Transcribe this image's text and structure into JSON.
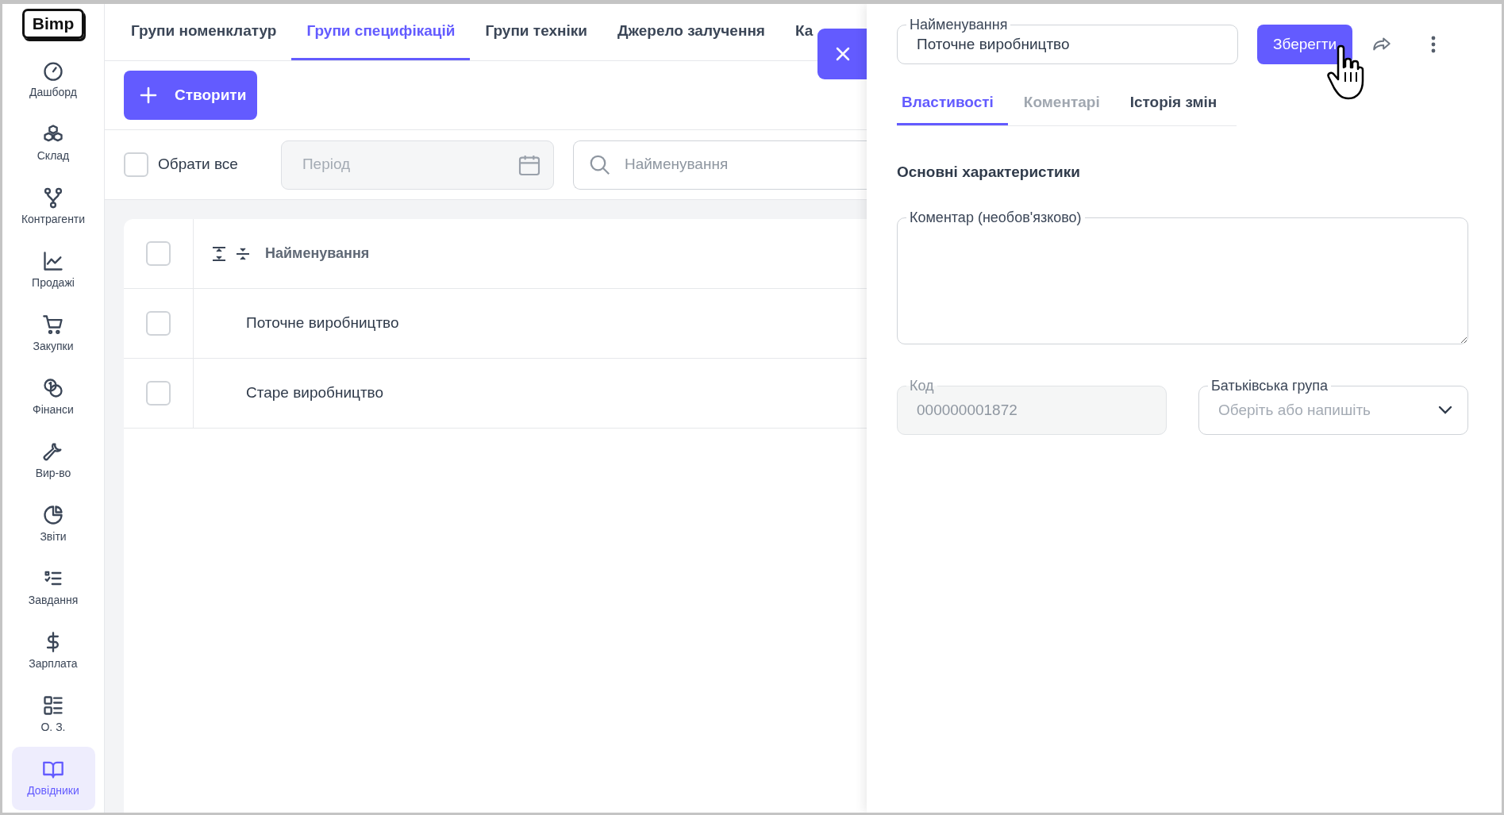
{
  "logo": "Bimp",
  "sidebar": {
    "items": [
      {
        "label": "Дашборд",
        "selected": false
      },
      {
        "label": "Склад",
        "selected": false
      },
      {
        "label": "Контрагенти",
        "selected": false
      },
      {
        "label": "Продажі",
        "selected": false
      },
      {
        "label": "Закупки",
        "selected": false
      },
      {
        "label": "Фінанси",
        "selected": false
      },
      {
        "label": "Вир-во",
        "selected": false
      },
      {
        "label": "Звіти",
        "selected": false
      },
      {
        "label": "Завдання",
        "selected": false
      },
      {
        "label": "Зарплата",
        "selected": false
      },
      {
        "label": "О. З.",
        "selected": false
      },
      {
        "label": "Довідники",
        "selected": true
      }
    ]
  },
  "tabs": [
    {
      "label": "Групи номенклатур",
      "selected": false
    },
    {
      "label": "Групи специфікацій",
      "selected": true
    },
    {
      "label": "Групи техніки",
      "selected": false
    },
    {
      "label": "Джерело залучення",
      "selected": false
    },
    {
      "label": "Ка",
      "selected": false
    }
  ],
  "create_button": "Створити",
  "filters": {
    "select_all": {
      "label": "Обрати все",
      "checked": false
    },
    "period": {
      "placeholder": "Період"
    },
    "search": {
      "placeholder": "Найменування"
    }
  },
  "table": {
    "select_all_checked": false,
    "columns": [
      "Найменування"
    ],
    "rows": [
      {
        "name": "Поточне виробництво",
        "checked": false
      },
      {
        "name": "Старе виробництво",
        "checked": false
      }
    ]
  },
  "panel": {
    "name_field": {
      "label": "Найменування",
      "value": "Поточне виробництво"
    },
    "save_button": "Зберегти",
    "tabs": [
      {
        "label": "Властивості",
        "selected": true,
        "disabled": false
      },
      {
        "label": "Коментарі",
        "selected": false,
        "disabled": true
      },
      {
        "label": "Історія змін",
        "selected": false,
        "disabled": false
      }
    ],
    "section_title": "Основні характеристики",
    "comment_field": {
      "label": "Коментар (необов'язково)"
    },
    "code_field": {
      "label": "Код",
      "value": "000000001872",
      "disabled": true
    },
    "parent_field": {
      "label": "Батьківська група",
      "placeholder": "Оберіть або напишіть"
    }
  }
}
